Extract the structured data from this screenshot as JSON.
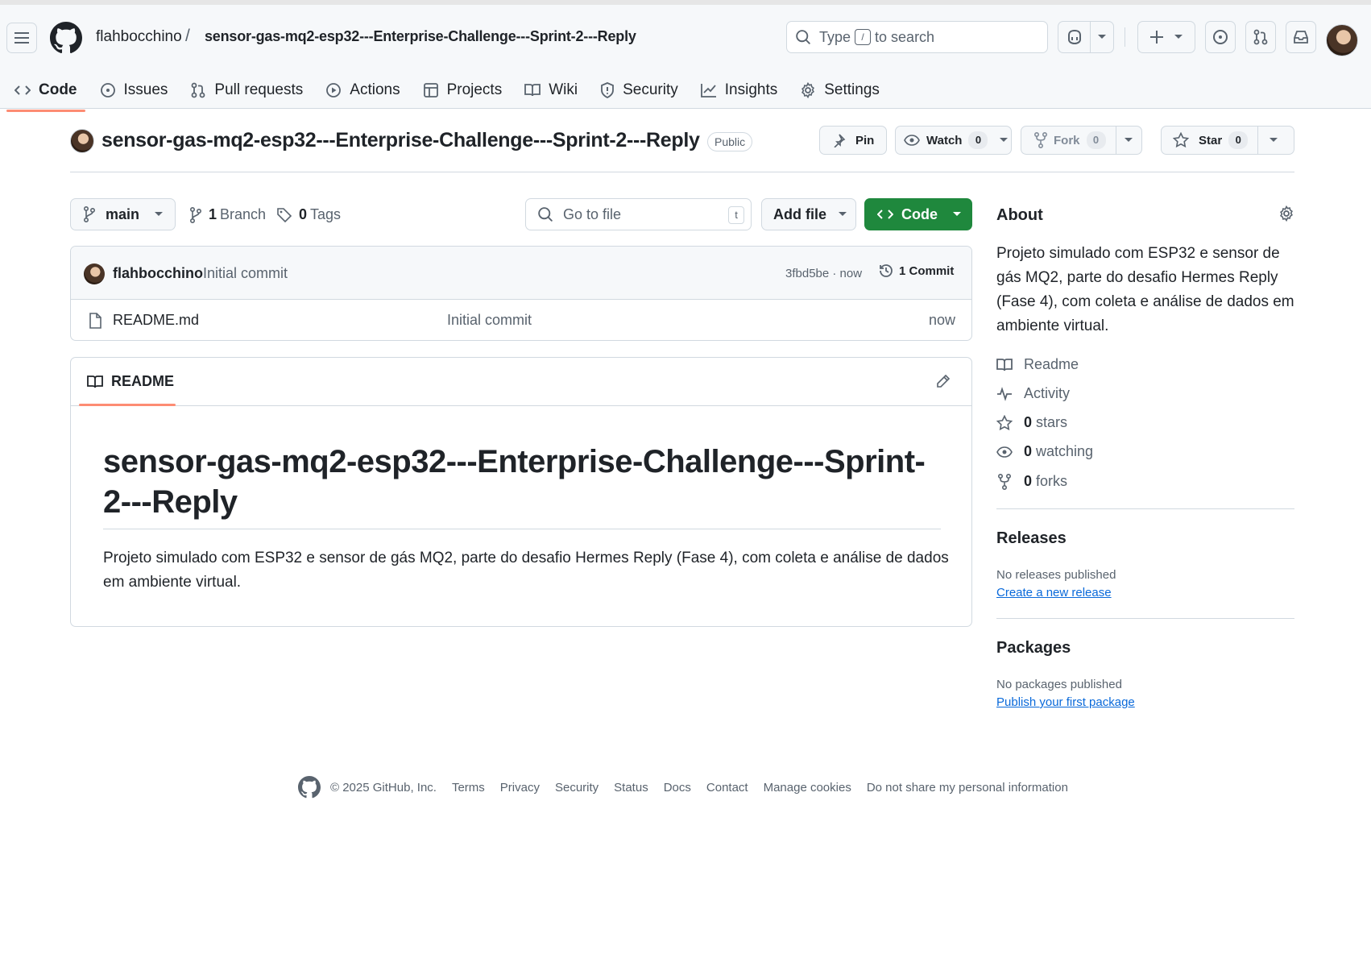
{
  "header": {
    "owner": "flahbocchino",
    "separator": "/",
    "repo": "sensor-gas-mq2-esp32---Enterprise-Challenge---Sprint-2---Reply",
    "search": {
      "before": "Type",
      "key": "/",
      "after": "to search"
    }
  },
  "tabs": [
    {
      "label": "Code",
      "icon": "code-icon"
    },
    {
      "label": "Issues",
      "icon": "issue-icon"
    },
    {
      "label": "Pull requests",
      "icon": "pull-request-icon"
    },
    {
      "label": "Actions",
      "icon": "play-icon"
    },
    {
      "label": "Projects",
      "icon": "table-icon"
    },
    {
      "label": "Wiki",
      "icon": "book-icon"
    },
    {
      "label": "Security",
      "icon": "shield-icon"
    },
    {
      "label": "Insights",
      "icon": "graph-icon"
    },
    {
      "label": "Settings",
      "icon": "gear-icon"
    }
  ],
  "repo": {
    "title": "sensor-gas-mq2-esp32---Enterprise-Challenge---Sprint-2---Reply",
    "visibility": "Public",
    "pin_label": "Pin",
    "watch_label": "Watch",
    "watch_count": "0",
    "fork_label": "Fork",
    "fork_count": "0",
    "star_label": "Star",
    "star_count": "0"
  },
  "filenav": {
    "branch": "main",
    "branches_count": "1",
    "branches_label": "Branch",
    "tags_count": "0",
    "tags_label": "Tags",
    "goto_placeholder": "Go to file",
    "goto_key": "t",
    "add_file": "Add file",
    "code": "Code"
  },
  "commit": {
    "author": "flahbocchino",
    "message": "Initial commit",
    "meta": "3fbd5be · now",
    "count_label": "1 Commit"
  },
  "files": [
    {
      "name": "README.md",
      "message": "Initial commit",
      "time": "now"
    }
  ],
  "readme": {
    "tab": "README",
    "heading": "sensor-gas-mq2-esp32---Enterprise-Challenge---Sprint-2---Reply",
    "body": "Projeto simulado com ESP32 e sensor de gás MQ2, parte do desafio Hermes Reply (Fase 4), com coleta e análise de dados em ambiente virtual."
  },
  "about": {
    "title": "About",
    "description": "Projeto simulado com ESP32 e sensor de gás MQ2, parte do desafio Hermes Reply (Fase 4), com coleta e análise de dados em ambiente virtual.",
    "readme": "Readme",
    "activity": "Activity",
    "stars_count": "0",
    "stars_label": "stars",
    "watching_count": "0",
    "watching_label": "watching",
    "forks_count": "0",
    "forks_label": "forks"
  },
  "releases": {
    "title": "Releases",
    "empty": "No releases published",
    "link": "Create a new release"
  },
  "packages": {
    "title": "Packages",
    "empty": "No packages published",
    "link": "Publish your first package"
  },
  "footer": {
    "copyright": "© 2025 GitHub, Inc.",
    "links": [
      "Terms",
      "Privacy",
      "Security",
      "Status",
      "Docs",
      "Contact",
      "Manage cookies",
      "Do not share my personal information"
    ]
  },
  "colors": {
    "accent_green": "#1f883d",
    "link_blue": "#0969da",
    "tab_underline": "#fd8c73"
  }
}
